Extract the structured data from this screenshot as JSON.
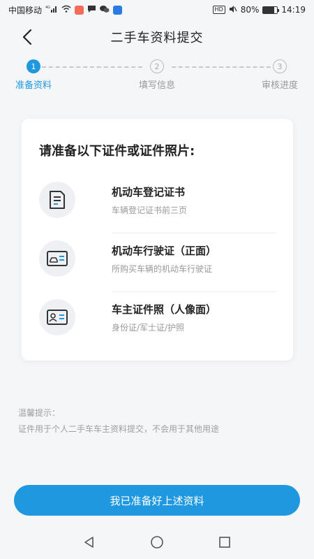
{
  "status_bar": {
    "carrier": "中国移动",
    "network": "4G",
    "hd": "HD",
    "battery": "80%",
    "battery_level": 0.8,
    "time": "14:19"
  },
  "header": {
    "title": "二手车资料提交"
  },
  "steps": [
    {
      "number": "1",
      "label": "准备资料",
      "active": true
    },
    {
      "number": "2",
      "label": "填写信息",
      "active": false
    },
    {
      "number": "3",
      "label": "审核进度",
      "active": false
    }
  ],
  "card": {
    "title": "请准备以下证件或证件照片:",
    "items": [
      {
        "name": "机动车登记证书",
        "desc": "车辆登记证书前三页",
        "icon": "document-icon"
      },
      {
        "name": "机动车行驶证（正面）",
        "desc": "所购买车辆的机动车行驶证",
        "icon": "vehicle-license-icon"
      },
      {
        "name": "车主证件照（人像面）",
        "desc": "身份证/军士证/护照",
        "icon": "id-card-icon"
      }
    ]
  },
  "tips": {
    "title": "温馨提示：",
    "text": "证件用于个人二手车车主资料提交，不会用于其他用途"
  },
  "submit": {
    "label": "我已准备好上述资料"
  },
  "colors": {
    "accent": "#1f98e0",
    "background": "#f5f6f8"
  }
}
